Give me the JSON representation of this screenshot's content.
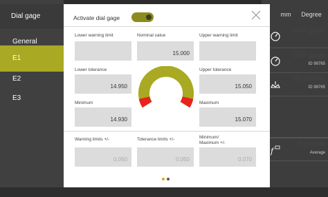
{
  "left_panel": {
    "title": "Dial gage",
    "items": [
      {
        "label": "General"
      },
      {
        "label": "E1"
      },
      {
        "label": "E2"
      },
      {
        "label": "E3"
      }
    ]
  },
  "right_panel": {
    "header": {
      "unit": "mm",
      "angle": "Degree"
    },
    "rows": [
      {
        "label": "Dial gage",
        "sub": "",
        "icon": "dial-gage-icon"
      },
      {
        "label": "Dial gage",
        "sub": "ID 98765",
        "icon": "dial-gage-icon"
      },
      {
        "label": "Mastering",
        "sub": "ID 98765",
        "icon": "mastering-icon"
      },
      {
        "label": "Formula",
        "sub": "Average",
        "icon": "formula-icon"
      }
    ]
  },
  "dialog": {
    "activate_label": "Activate dial gage",
    "activate_on": true,
    "fields": {
      "lower_warning_limit": {
        "label": "Lower warning limit",
        "value": ""
      },
      "nominal_value": {
        "label": "Nominal value",
        "value": "15.000"
      },
      "upper_warning_limit": {
        "label": "Upper warning limit",
        "value": ""
      },
      "lower_tolerance": {
        "label": "Lower tolerance",
        "value": "14.950"
      },
      "upper_tolerance": {
        "label": "Upper tolerance",
        "value": "15.050"
      },
      "minimum": {
        "label": "Minimum",
        "value": "14.930"
      },
      "maximum": {
        "label": "Maximum",
        "value": "15.070"
      },
      "warning_limits": {
        "label": "Warning limits +/-",
        "value": "0.050"
      },
      "tolerance_limits": {
        "label": "Tolerance limits +/-",
        "value": "0.050"
      },
      "min_max": {
        "label_line1": "Minimum/",
        "label_line2": "Maximum +/-",
        "value": "0.070"
      }
    },
    "colors": {
      "accent": "#a9a923",
      "red": "#e8231c",
      "field": "#dcdcdc"
    },
    "pager": {
      "pages": 2,
      "current": 1
    }
  }
}
